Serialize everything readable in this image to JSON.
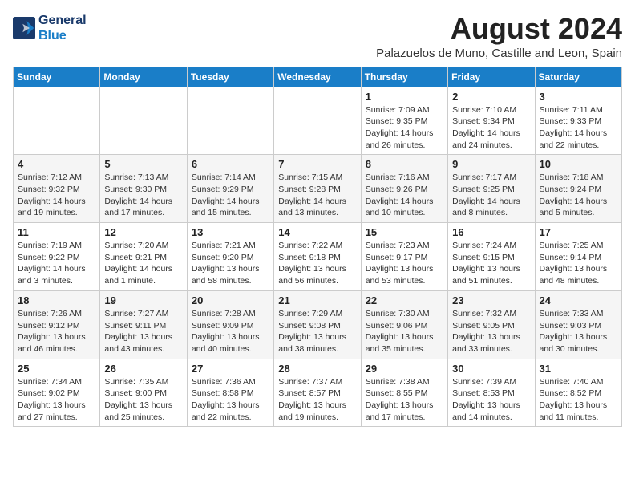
{
  "header": {
    "logo_line1": "General",
    "logo_line2": "Blue",
    "month_year": "August 2024",
    "location": "Palazuelos de Muno, Castille and Leon, Spain"
  },
  "columns": [
    "Sunday",
    "Monday",
    "Tuesday",
    "Wednesday",
    "Thursday",
    "Friday",
    "Saturday"
  ],
  "weeks": [
    [
      {
        "day": "",
        "info": ""
      },
      {
        "day": "",
        "info": ""
      },
      {
        "day": "",
        "info": ""
      },
      {
        "day": "",
        "info": ""
      },
      {
        "day": "1",
        "info": "Sunrise: 7:09 AM\nSunset: 9:35 PM\nDaylight: 14 hours\nand 26 minutes."
      },
      {
        "day": "2",
        "info": "Sunrise: 7:10 AM\nSunset: 9:34 PM\nDaylight: 14 hours\nand 24 minutes."
      },
      {
        "day": "3",
        "info": "Sunrise: 7:11 AM\nSunset: 9:33 PM\nDaylight: 14 hours\nand 22 minutes."
      }
    ],
    [
      {
        "day": "4",
        "info": "Sunrise: 7:12 AM\nSunset: 9:32 PM\nDaylight: 14 hours\nand 19 minutes."
      },
      {
        "day": "5",
        "info": "Sunrise: 7:13 AM\nSunset: 9:30 PM\nDaylight: 14 hours\nand 17 minutes."
      },
      {
        "day": "6",
        "info": "Sunrise: 7:14 AM\nSunset: 9:29 PM\nDaylight: 14 hours\nand 15 minutes."
      },
      {
        "day": "7",
        "info": "Sunrise: 7:15 AM\nSunset: 9:28 PM\nDaylight: 14 hours\nand 13 minutes."
      },
      {
        "day": "8",
        "info": "Sunrise: 7:16 AM\nSunset: 9:26 PM\nDaylight: 14 hours\nand 10 minutes."
      },
      {
        "day": "9",
        "info": "Sunrise: 7:17 AM\nSunset: 9:25 PM\nDaylight: 14 hours\nand 8 minutes."
      },
      {
        "day": "10",
        "info": "Sunrise: 7:18 AM\nSunset: 9:24 PM\nDaylight: 14 hours\nand 5 minutes."
      }
    ],
    [
      {
        "day": "11",
        "info": "Sunrise: 7:19 AM\nSunset: 9:22 PM\nDaylight: 14 hours\nand 3 minutes."
      },
      {
        "day": "12",
        "info": "Sunrise: 7:20 AM\nSunset: 9:21 PM\nDaylight: 14 hours\nand 1 minute."
      },
      {
        "day": "13",
        "info": "Sunrise: 7:21 AM\nSunset: 9:20 PM\nDaylight: 13 hours\nand 58 minutes."
      },
      {
        "day": "14",
        "info": "Sunrise: 7:22 AM\nSunset: 9:18 PM\nDaylight: 13 hours\nand 56 minutes."
      },
      {
        "day": "15",
        "info": "Sunrise: 7:23 AM\nSunset: 9:17 PM\nDaylight: 13 hours\nand 53 minutes."
      },
      {
        "day": "16",
        "info": "Sunrise: 7:24 AM\nSunset: 9:15 PM\nDaylight: 13 hours\nand 51 minutes."
      },
      {
        "day": "17",
        "info": "Sunrise: 7:25 AM\nSunset: 9:14 PM\nDaylight: 13 hours\nand 48 minutes."
      }
    ],
    [
      {
        "day": "18",
        "info": "Sunrise: 7:26 AM\nSunset: 9:12 PM\nDaylight: 13 hours\nand 46 minutes."
      },
      {
        "day": "19",
        "info": "Sunrise: 7:27 AM\nSunset: 9:11 PM\nDaylight: 13 hours\nand 43 minutes."
      },
      {
        "day": "20",
        "info": "Sunrise: 7:28 AM\nSunset: 9:09 PM\nDaylight: 13 hours\nand 40 minutes."
      },
      {
        "day": "21",
        "info": "Sunrise: 7:29 AM\nSunset: 9:08 PM\nDaylight: 13 hours\nand 38 minutes."
      },
      {
        "day": "22",
        "info": "Sunrise: 7:30 AM\nSunset: 9:06 PM\nDaylight: 13 hours\nand 35 minutes."
      },
      {
        "day": "23",
        "info": "Sunrise: 7:32 AM\nSunset: 9:05 PM\nDaylight: 13 hours\nand 33 minutes."
      },
      {
        "day": "24",
        "info": "Sunrise: 7:33 AM\nSunset: 9:03 PM\nDaylight: 13 hours\nand 30 minutes."
      }
    ],
    [
      {
        "day": "25",
        "info": "Sunrise: 7:34 AM\nSunset: 9:02 PM\nDaylight: 13 hours\nand 27 minutes."
      },
      {
        "day": "26",
        "info": "Sunrise: 7:35 AM\nSunset: 9:00 PM\nDaylight: 13 hours\nand 25 minutes."
      },
      {
        "day": "27",
        "info": "Sunrise: 7:36 AM\nSunset: 8:58 PM\nDaylight: 13 hours\nand 22 minutes."
      },
      {
        "day": "28",
        "info": "Sunrise: 7:37 AM\nSunset: 8:57 PM\nDaylight: 13 hours\nand 19 minutes."
      },
      {
        "day": "29",
        "info": "Sunrise: 7:38 AM\nSunset: 8:55 PM\nDaylight: 13 hours\nand 17 minutes."
      },
      {
        "day": "30",
        "info": "Sunrise: 7:39 AM\nSunset: 8:53 PM\nDaylight: 13 hours\nand 14 minutes."
      },
      {
        "day": "31",
        "info": "Sunrise: 7:40 AM\nSunset: 8:52 PM\nDaylight: 13 hours\nand 11 minutes."
      }
    ]
  ]
}
